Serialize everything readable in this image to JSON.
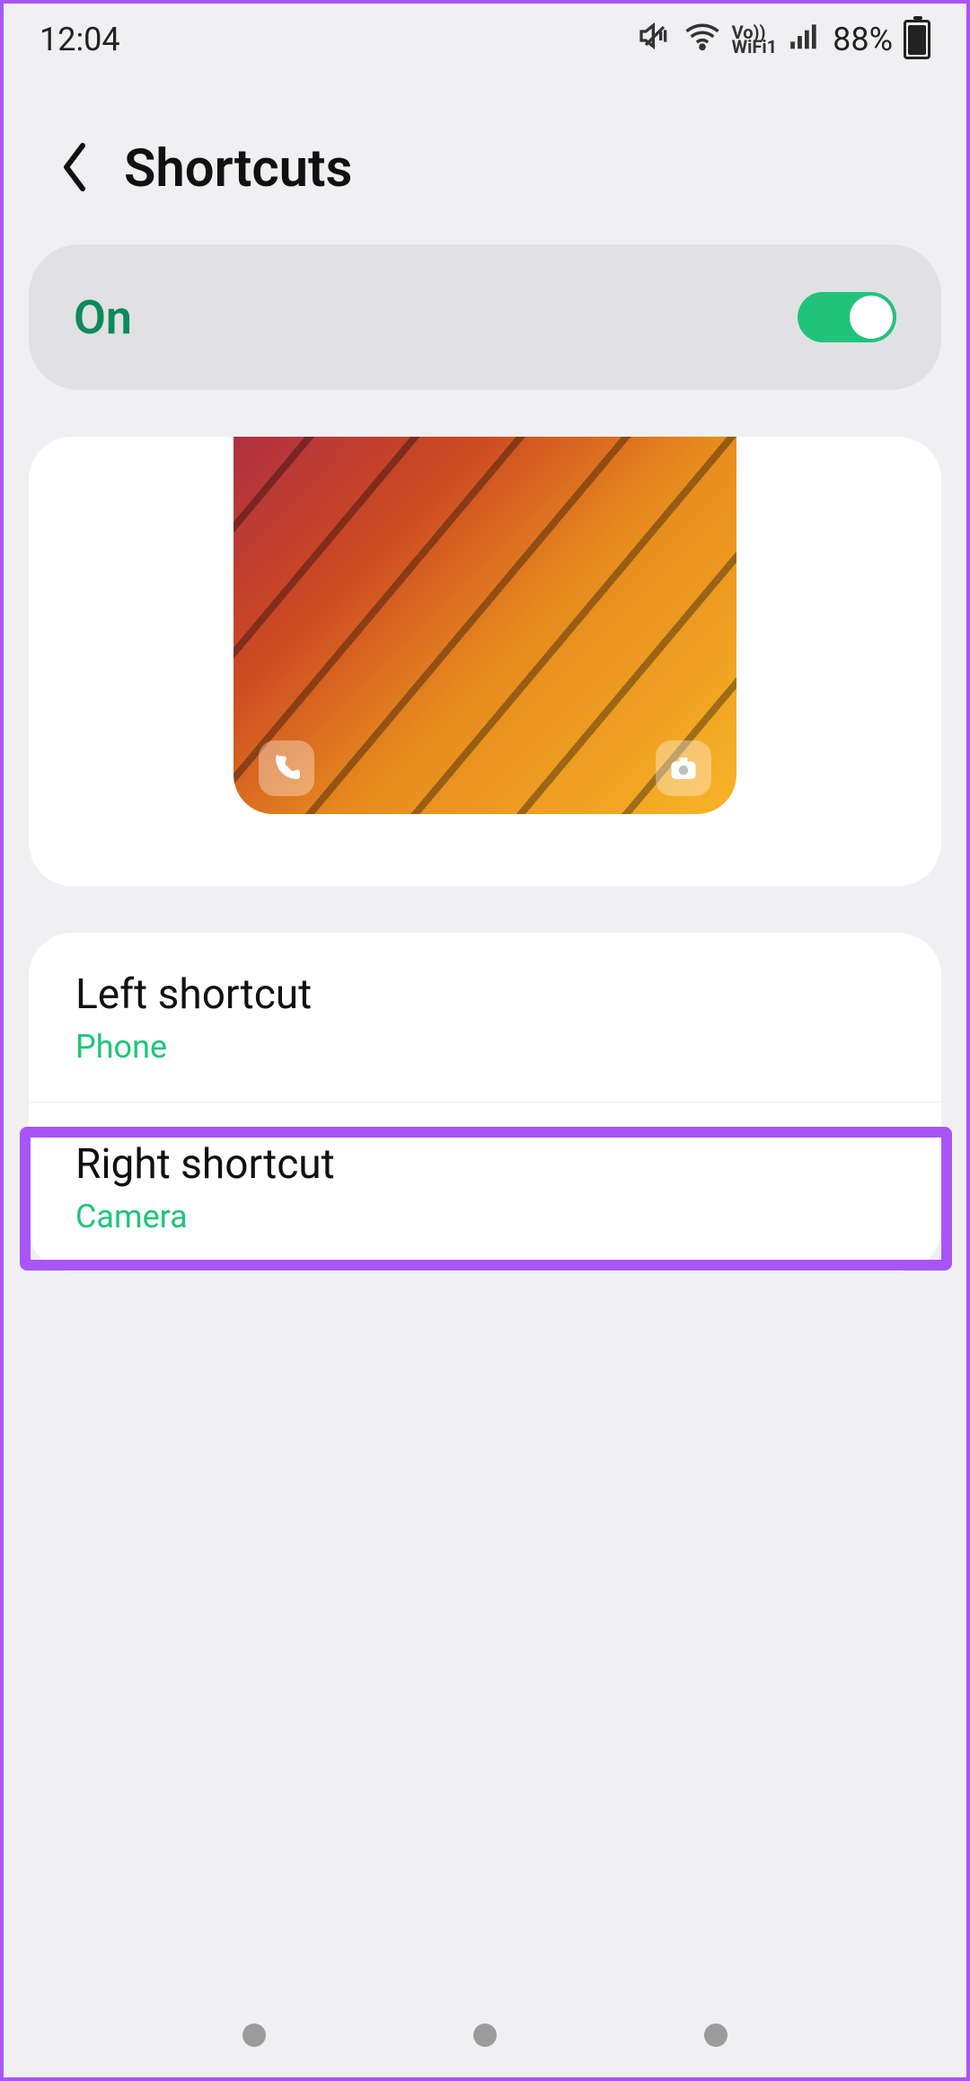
{
  "statusbar": {
    "time": "12:04",
    "battery_pct": "88%",
    "vowifi": "Vo))\nWiFi1"
  },
  "header": {
    "title": "Shortcuts"
  },
  "toggle": {
    "label": "On",
    "state": true
  },
  "preview": {
    "left_icon": "phone-icon",
    "right_icon": "camera-icon"
  },
  "shortcuts": {
    "left": {
      "title": "Left shortcut",
      "value": "Phone"
    },
    "right": {
      "title": "Right shortcut",
      "value": "Camera"
    }
  }
}
